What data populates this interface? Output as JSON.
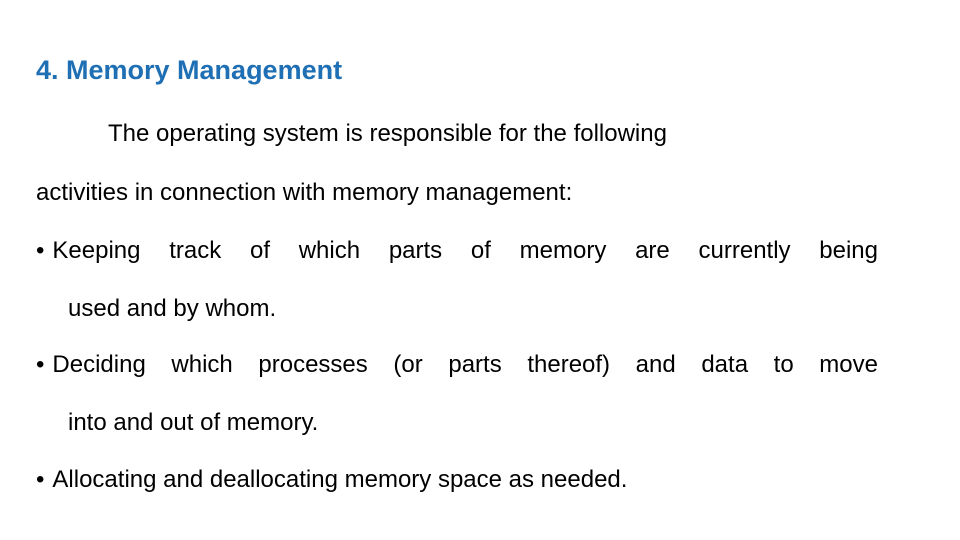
{
  "slide": {
    "title": "4. Memory Management",
    "intro_line1": "The operating system is responsible for the following",
    "intro_line2": "activities in connection with memory management:",
    "bullet_glyph": "•",
    "bullets": [
      {
        "line1": "Keeping track of which parts of memory are currently being",
        "line2": "used and by whom."
      },
      {
        "line1": "Deciding which processes (or parts thereof) and data to move",
        "line2": "into and out of memory."
      },
      {
        "line1": "Allocating and deallocating memory space as needed."
      }
    ]
  },
  "colors": {
    "title": "#1f6fb5",
    "body_text": "#000000",
    "background": "#ffffff"
  }
}
